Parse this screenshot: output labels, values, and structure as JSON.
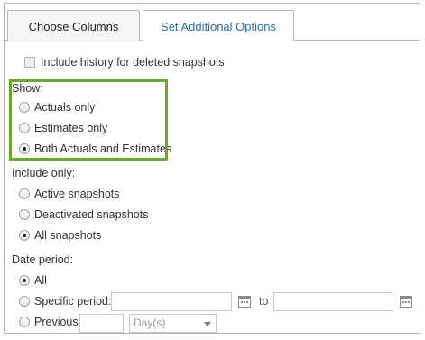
{
  "tabs": {
    "choose_columns": "Choose Columns",
    "set_additional_options": "Set Additional Options"
  },
  "history": {
    "label": "Include history for deleted snapshots",
    "checked": false
  },
  "show": {
    "label": "Show:",
    "options": [
      {
        "label": "Actuals only",
        "checked": false
      },
      {
        "label": "Estimates only",
        "checked": false
      },
      {
        "label": "Both Actuals and Estimates",
        "checked": true
      }
    ],
    "highlight_color": "#6aa833"
  },
  "include_only": {
    "label": "Include only:",
    "options": [
      {
        "label": "Active snapshots",
        "checked": false
      },
      {
        "label": "Deactivated snapshots",
        "checked": false
      },
      {
        "label": "All snapshots",
        "checked": true
      }
    ]
  },
  "date_period": {
    "label": "Date period:",
    "all_label": "All",
    "specific_label": "Specific period:",
    "to_label": "to",
    "previous_label": "Previous",
    "unit_placeholder": "Day(s)"
  }
}
